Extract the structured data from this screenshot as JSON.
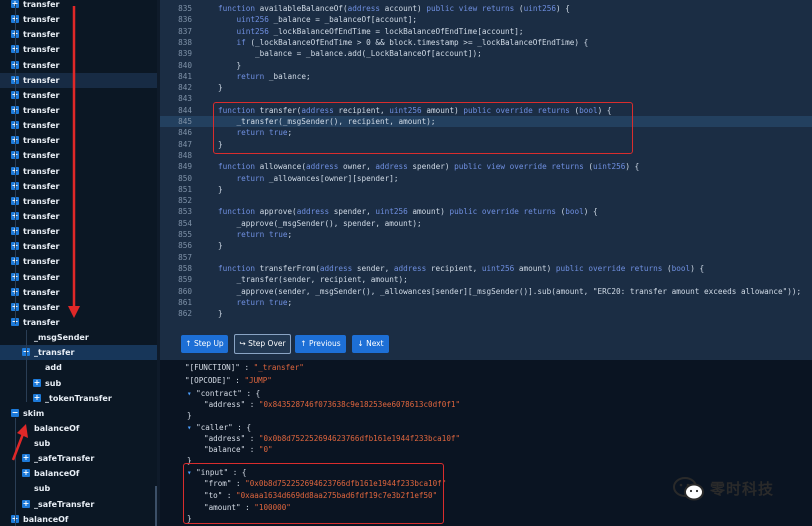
{
  "sidebar": {
    "rows": [
      {
        "label": "transfer",
        "icon": "plus"
      },
      {
        "label": "transfer",
        "icon": "plus"
      },
      {
        "label": "transfer",
        "icon": "plus"
      },
      {
        "label": "transfer",
        "icon": "plus"
      },
      {
        "label": "transfer",
        "icon": "plus"
      },
      {
        "label": "transfer",
        "icon": "plus"
      },
      {
        "label": "transfer",
        "icon": "plus"
      },
      {
        "label": "transfer",
        "icon": "plus"
      },
      {
        "label": "transfer",
        "icon": "plus"
      },
      {
        "label": "transfer",
        "icon": "plus"
      },
      {
        "label": "transfer",
        "icon": "plus"
      },
      {
        "label": "transfer",
        "icon": "plus"
      },
      {
        "label": "transfer",
        "icon": "plus"
      },
      {
        "label": "transfer",
        "icon": "plus"
      },
      {
        "label": "transfer",
        "icon": "plus"
      },
      {
        "label": "transfer",
        "icon": "plus"
      },
      {
        "label": "transfer",
        "icon": "plus"
      },
      {
        "label": "transfer",
        "icon": "plus"
      },
      {
        "label": "transfer",
        "icon": "plus"
      },
      {
        "label": "transfer",
        "icon": "plus"
      },
      {
        "label": "transfer",
        "icon": "plus"
      },
      {
        "label": "transfer",
        "icon": "minus"
      },
      {
        "label": "_msgSender",
        "icon": "none"
      },
      {
        "label": "_transfer",
        "icon": "minus"
      },
      {
        "label": "add",
        "icon": "none"
      },
      {
        "label": "sub",
        "icon": "plus"
      },
      {
        "label": "_tokenTransfer",
        "icon": "plus"
      },
      {
        "label": "skim",
        "icon": "minus"
      },
      {
        "label": "balanceOf",
        "icon": "none"
      },
      {
        "label": "sub",
        "icon": "none"
      },
      {
        "label": "_safeTransfer",
        "icon": "plus"
      },
      {
        "label": "balanceOf",
        "icon": "plus"
      },
      {
        "label": "sub",
        "icon": "none"
      },
      {
        "label": "_safeTransfer",
        "icon": "plus"
      },
      {
        "label": "balanceOf",
        "icon": "plus"
      }
    ]
  },
  "code": {
    "lines": [
      {
        "n": "835",
        "t": "function availableBalanceOf(address account) public view returns (uint256) {"
      },
      {
        "n": "836",
        "t": "    uint256 _balance = _balanceOf[account];"
      },
      {
        "n": "837",
        "t": "    uint256 _lockBalanceOfEndTime = lockBalanceOfEndTime[account];"
      },
      {
        "n": "838",
        "t": "    if (_lockBalanceOfEndTime > 0 && block.timestamp >= _lockBalanceOfEndTime) {"
      },
      {
        "n": "839",
        "t": "        _balance = _balance.add(_LockBalanceOf[account]);"
      },
      {
        "n": "840",
        "t": "    }"
      },
      {
        "n": "841",
        "t": "    return _balance;"
      },
      {
        "n": "842",
        "t": "}"
      },
      {
        "n": "843",
        "t": ""
      },
      {
        "n": "844",
        "t": "function transfer(address recipient, uint256 amount) public override returns (bool) {"
      },
      {
        "n": "845",
        "t": "    _transfer(_msgSender(), recipient, amount);"
      },
      {
        "n": "846",
        "t": "    return true;"
      },
      {
        "n": "847",
        "t": "}"
      },
      {
        "n": "848",
        "t": ""
      },
      {
        "n": "849",
        "t": "function allowance(address owner, address spender) public view override returns (uint256) {"
      },
      {
        "n": "850",
        "t": "    return _allowances[owner][spender];"
      },
      {
        "n": "851",
        "t": "}"
      },
      {
        "n": "852",
        "t": ""
      },
      {
        "n": "853",
        "t": "function approve(address spender, uint256 amount) public override returns (bool) {"
      },
      {
        "n": "854",
        "t": "    _approve(_msgSender(), spender, amount);"
      },
      {
        "n": "855",
        "t": "    return true;"
      },
      {
        "n": "856",
        "t": "}"
      },
      {
        "n": "857",
        "t": ""
      },
      {
        "n": "858",
        "t": "function transferFrom(address sender, address recipient, uint256 amount) public override returns (bool) {"
      },
      {
        "n": "859",
        "t": "    _transfer(sender, recipient, amount);"
      },
      {
        "n": "860",
        "t": "    _approve(sender, _msgSender(), _allowances[sender][_msgSender()].sub(amount, \"ERC20: transfer amount exceeds allowance\"));"
      },
      {
        "n": "861",
        "t": "    return true;"
      },
      {
        "n": "862",
        "t": "}"
      }
    ],
    "highlight_line": "845"
  },
  "toolbar": {
    "step_up": "Step Up",
    "step_over": "Step Over",
    "previous": "Previous",
    "next": "Next"
  },
  "debug": {
    "function_key": "\"[FUNCTION]\"",
    "function_val": "\"_transfer\"",
    "opcode_key": "\"[OPCODE]\"",
    "opcode_val": "\"JUMP\"",
    "contract_key": "\"contract\"",
    "contract_address_key": "\"address\"",
    "contract_address_val": "\"0x843528746f073638c9e18253ee6078613c0df0f1\"",
    "caller_key": "\"caller\"",
    "caller_address_key": "\"address\"",
    "caller_address_val": "\"0x0b8d752252694623766dfb161e1944f233bca10f\"",
    "caller_balance_key": "\"balance\"",
    "caller_balance_val": "\"0\"",
    "input_key": "\"input\"",
    "from_key": "\"from\"",
    "from_val": "\"0x0b8d752252694623766dfb161e1944f233bca10f\"",
    "to_key": "\"to\"",
    "to_val": "\"0xaaa1634d669dd8aa275bad6fdf19c7e3b2f1ef50\"",
    "amount_key": "\"amount\"",
    "amount_val": "\"100000\""
  },
  "watermark": {
    "text": "零时科技"
  },
  "colors": {
    "accent": "#1d6fd6",
    "annotation_red": "#d92d2d",
    "string": "#e0663e",
    "keyword": "#6f8fe0"
  }
}
